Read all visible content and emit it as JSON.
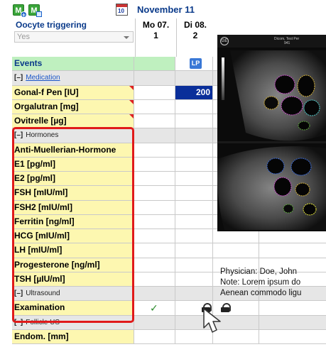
{
  "toolbar": {
    "add_icon_letter": "M",
    "edit_icon_letter": "M",
    "calendar_icon_text": "10"
  },
  "header": {
    "month": "November 11",
    "trigger_label": "Oocyte triggering",
    "trigger_value": "Yes",
    "days": [
      {
        "weekday": "Mo 07.",
        "num": "1"
      },
      {
        "weekday": "Di 08.",
        "num": "2"
      }
    ]
  },
  "events": {
    "label": "Events",
    "badge": "LP"
  },
  "sections": {
    "medication": {
      "toggle": "[–]",
      "label": "Medication"
    },
    "hormones": {
      "toggle": "[–]",
      "label": "Hormones"
    },
    "ultrasound": {
      "toggle": "[–]",
      "label": "Ultrasound"
    },
    "follicle": {
      "toggle": "[–]",
      "label": "Follicle US"
    }
  },
  "medication_rows": [
    {
      "label": "Gonal-f Pen [IU]",
      "value": "200"
    },
    {
      "label": "Orgalutran [mg]"
    },
    {
      "label": "Ovitrelle [µg]"
    }
  ],
  "hormone_rows": [
    "Anti-Muellerian-Hormone",
    "E1  [pg/ml]",
    "E2  [pg/ml]",
    "FSH  [mIU/ml]",
    "FSH2  [mIU/ml]",
    "Ferritin  [ng/ml]",
    "HCG  [mIU/ml]",
    "LH  [mIU/ml]",
    "Progesterone  [ng/ml]",
    "TSH  [µIU/ml]"
  ],
  "examination": {
    "label": "Examination",
    "check": "✓"
  },
  "endom": {
    "label": "Endom. [mm]"
  },
  "ultrasound_image": {
    "logo": "GE",
    "patient": "Dicom, Test Per",
    "sub": "941"
  },
  "info": {
    "physician": "Physician: Doe, John",
    "note": "Note: Lorem ipsum do",
    "text": "Aenean commodo ligu"
  },
  "colors": {
    "label_yellow": "#fdf7b0",
    "events_green": "#bff0bf",
    "highlight_red": "#e01a1a",
    "selected_blue": "#0a2f9a",
    "header_blue": "#0a3a8a"
  }
}
